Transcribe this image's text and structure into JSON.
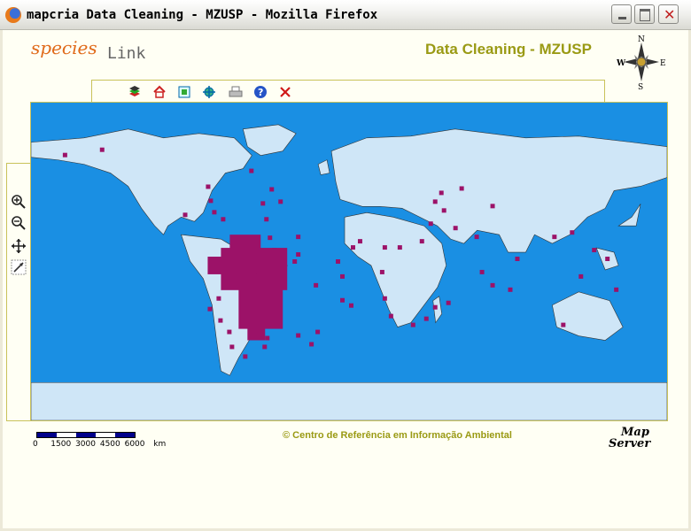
{
  "window": {
    "title": "mapcria Data Cleaning - MZUSP - Mozilla Firefox"
  },
  "logo": {
    "part1": "species",
    "part2": "Link"
  },
  "header": {
    "title": "Data Cleaning - MZUSP"
  },
  "compass": {
    "n": "N",
    "s": "S",
    "e": "E",
    "w": "W"
  },
  "toolbar": {
    "tools": [
      "layers-icon",
      "home-icon",
      "zoom-extent-icon",
      "pan-center-icon",
      "print-icon",
      "help-icon",
      "close-icon"
    ]
  },
  "sidetools": {
    "tools": [
      "zoom-in-icon",
      "zoom-out-icon",
      "pan-icon",
      "identify-icon"
    ]
  },
  "footer": {
    "credit": "© Centro de Referência em Informação Ambiental"
  },
  "scale": {
    "label": "0   1500 3000 4500 6000  km"
  },
  "mapserver": {
    "line1": "Map",
    "line2": "Server"
  },
  "colors": {
    "ocean": "#1a8fe3",
    "land": "#cfe6f7",
    "points": "#9c1268",
    "accent": "#9a9a14"
  }
}
